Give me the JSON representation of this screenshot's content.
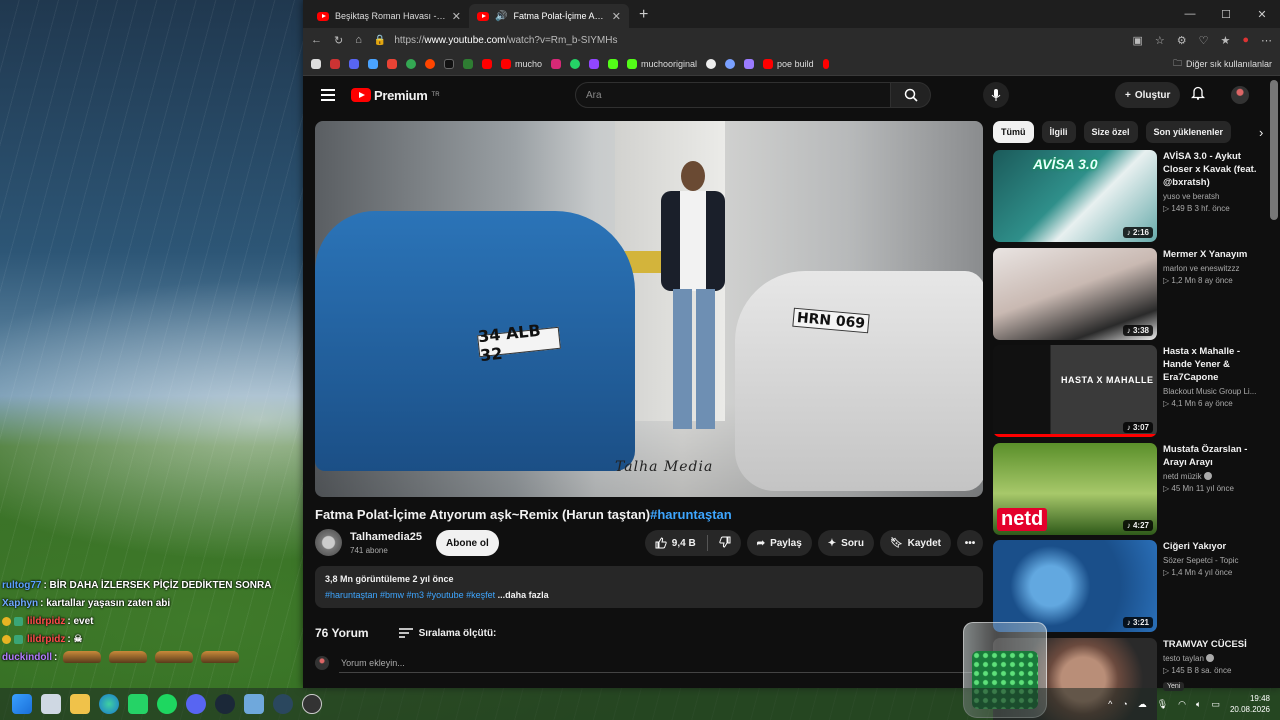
{
  "browser": {
    "tabs": [
      {
        "title": "Beşiktaş Roman Havası - YouTube",
        "active": false
      },
      {
        "title": "Fatma Polat-İçime Atıyorum aşk~Remix (Harun taştan)",
        "active": true
      }
    ],
    "url_prefix": "https://",
    "url_host": "www.youtube.com",
    "url_path": "/watch?v=Rm_b-SIYMHs",
    "bookmarks": [
      "mucho",
      "muchooriginal",
      "poe build"
    ],
    "other_bookmarks": "Diğer sık kullanılanlar"
  },
  "youtube": {
    "logo": "Premium",
    "logo_region": "TR",
    "search_placeholder": "Ara",
    "create_label": "Oluştur",
    "player": {
      "plate_left": "34 ALB 32",
      "plate_right": "HRN 069",
      "watermark": "Talha Media"
    },
    "video": {
      "title": "Fatma Polat-İçime Atıyorum aşk~Remix (Harun taştan)",
      "title_hashtag": "#haruntaştan",
      "channel": "Talhamedia25",
      "subscribers": "741 abone",
      "subscribe_label": "Abone ol",
      "likes": "9,4 B",
      "share_label": "Paylaş",
      "ask_label": "Soru",
      "save_label": "Kaydet",
      "views_date": "3,8 Mn görüntüleme  2 yıl önce",
      "tags": "#haruntaştan #bmw #m3 #youtube #keşfet",
      "more_label": "...daha fazla",
      "comment_count": "76 Yorum",
      "sort_label": "Sıralama ölçütü:",
      "add_comment_placeholder": "Yorum ekleyin..."
    },
    "chips": [
      "Tümü",
      "İlgili",
      "Size özel",
      "Son yüklenenler"
    ],
    "related": [
      {
        "title": "AVİSA 3.0 - Aykut Closer x Kavak (feat. @bxratsh)",
        "channel": "yuso ve beratsh",
        "stats": "▷ 149 B  3 hf. önce",
        "duration": "2:16",
        "verified": false,
        "thumb": "avisa",
        "thumb_text": "AVİSA 3.0"
      },
      {
        "title": "Mermer X Yanayım",
        "channel": "marlon ve eneswitzzz",
        "stats": "▷ 1,2 Mn  8 ay önce",
        "duration": "3:38",
        "verified": false,
        "thumb": "hands",
        "thumb_text": ""
      },
      {
        "title": "Hasta x Mahalle - Hande Yener & Era7Capone",
        "channel": "Blackout Music Group Li...",
        "stats": "▷ 4,1 Mn  6 ay önce",
        "duration": "3:07",
        "verified": false,
        "thumb": "hasta",
        "thumb_text": "HASTA X MAHALLE",
        "progress": 1.0
      },
      {
        "title": "Mustafa Özarslan - Arayı Arayı",
        "channel": "netd müzik",
        "stats": "▷ 45 Mn  11 yıl önce",
        "duration": "4:27",
        "verified": true,
        "thumb": "netd",
        "thumb_text": "netd"
      },
      {
        "title": "Ciğeri Yakıyor",
        "channel": "Sözer Sepetci - Topic",
        "stats": "▷ 1,4 Mn  4 yıl önce",
        "duration": "3:21",
        "verified": false,
        "thumb": "blue",
        "thumb_text": ""
      },
      {
        "title": "TRAMVAY CÜCESİ",
        "channel": "testo taylan",
        "stats": "▷ 145 B  8 sa. önce",
        "duration": "",
        "verified": true,
        "thumb": "face",
        "thumb_text": "",
        "new": "Yeni"
      }
    ]
  },
  "chat": [
    {
      "user": "rultog77",
      "user_color": "#5aa0ff",
      "msg": " : BİR DAHA İZLERSEK PİÇİZ DEDİKTEN SONRA",
      "badges": false,
      "emotes": 0
    },
    {
      "user": "Xaphyn",
      "user_color": "#6fa8ff",
      "msg": " : kartallar yaşasın zaten abi",
      "badges": false,
      "emotes": 0
    },
    {
      "user": "lildrpidz",
      "user_color": "#ff4a4a",
      "msg": " : evet",
      "badges": true,
      "emotes": 0
    },
    {
      "user": "lildrpidz",
      "user_color": "#ff4a4a",
      "msg": " : ☠",
      "badges": true,
      "emotes": 0
    },
    {
      "user": "duckindoll",
      "user_color": "#b37bff",
      "msg": " :",
      "badges": false,
      "emotes": 4
    }
  ],
  "taskbar": {
    "time": "19:48",
    "date": "20.08.2026"
  },
  "colors": {
    "yt_red": "#ff0000",
    "link_blue": "#3ea6ff",
    "bg": "#0f0f0f"
  }
}
